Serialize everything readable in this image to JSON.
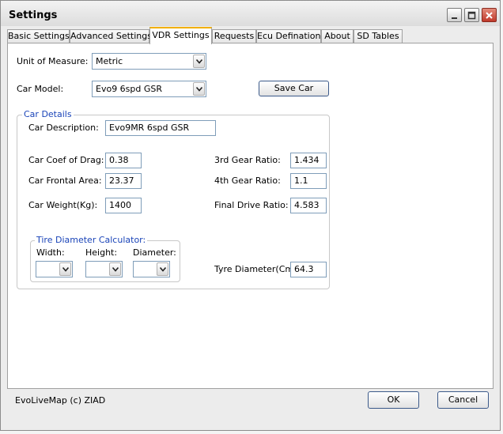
{
  "window": {
    "title": "Settings"
  },
  "tabs": [
    {
      "label": "Basic Settings"
    },
    {
      "label": "Advanced Settings"
    },
    {
      "label": "VDR Settings"
    },
    {
      "label": "Requests"
    },
    {
      "label": "Ecu Defination"
    },
    {
      "label": "About"
    },
    {
      "label": "SD Tables"
    }
  ],
  "active_tab": "VDR Settings",
  "units": {
    "label": "Unit of Measure:",
    "value": "Metric"
  },
  "car_model": {
    "label": "Car Model:",
    "value": "Evo9 6spd GSR"
  },
  "save_car_label": "Save Car",
  "car_details": {
    "legend": "Car Details",
    "description_label": "Car Description:",
    "description_value": "Evo9MR 6spd GSR",
    "drag_label": "Car Coef of Drag:",
    "drag_value": "0.38",
    "frontal_label": "Car Frontal Area:",
    "frontal_value": "23.37",
    "weight_label": "Car Weight(Kg):",
    "weight_value": "1400",
    "gear3_label": "3rd Gear Ratio:",
    "gear3_value": "1.434",
    "gear4_label": "4th Gear Ratio:",
    "gear4_value": "1.1",
    "final_label": "Final Drive Ratio:",
    "final_value": "4.583",
    "tyre_label": "Tyre Diameter(Cm):",
    "tyre_value": "64.3"
  },
  "tire_calc": {
    "legend": "Tire Diameter Calculator:",
    "width_label": "Width:",
    "height_label": "Height:",
    "diameter_label": "Diameter:"
  },
  "footer": {
    "copyright": "EvoLiveMap (c) ZIAD",
    "ok_label": "OK",
    "cancel_label": "Cancel"
  },
  "colors": {
    "legend_text": "#1a44b8",
    "active_tab_accent": "#f2b000",
    "close_button": "#c0392b"
  },
  "icons": [
    "minimize-icon",
    "maximize-icon",
    "close-icon",
    "chevron-down-icon"
  ]
}
